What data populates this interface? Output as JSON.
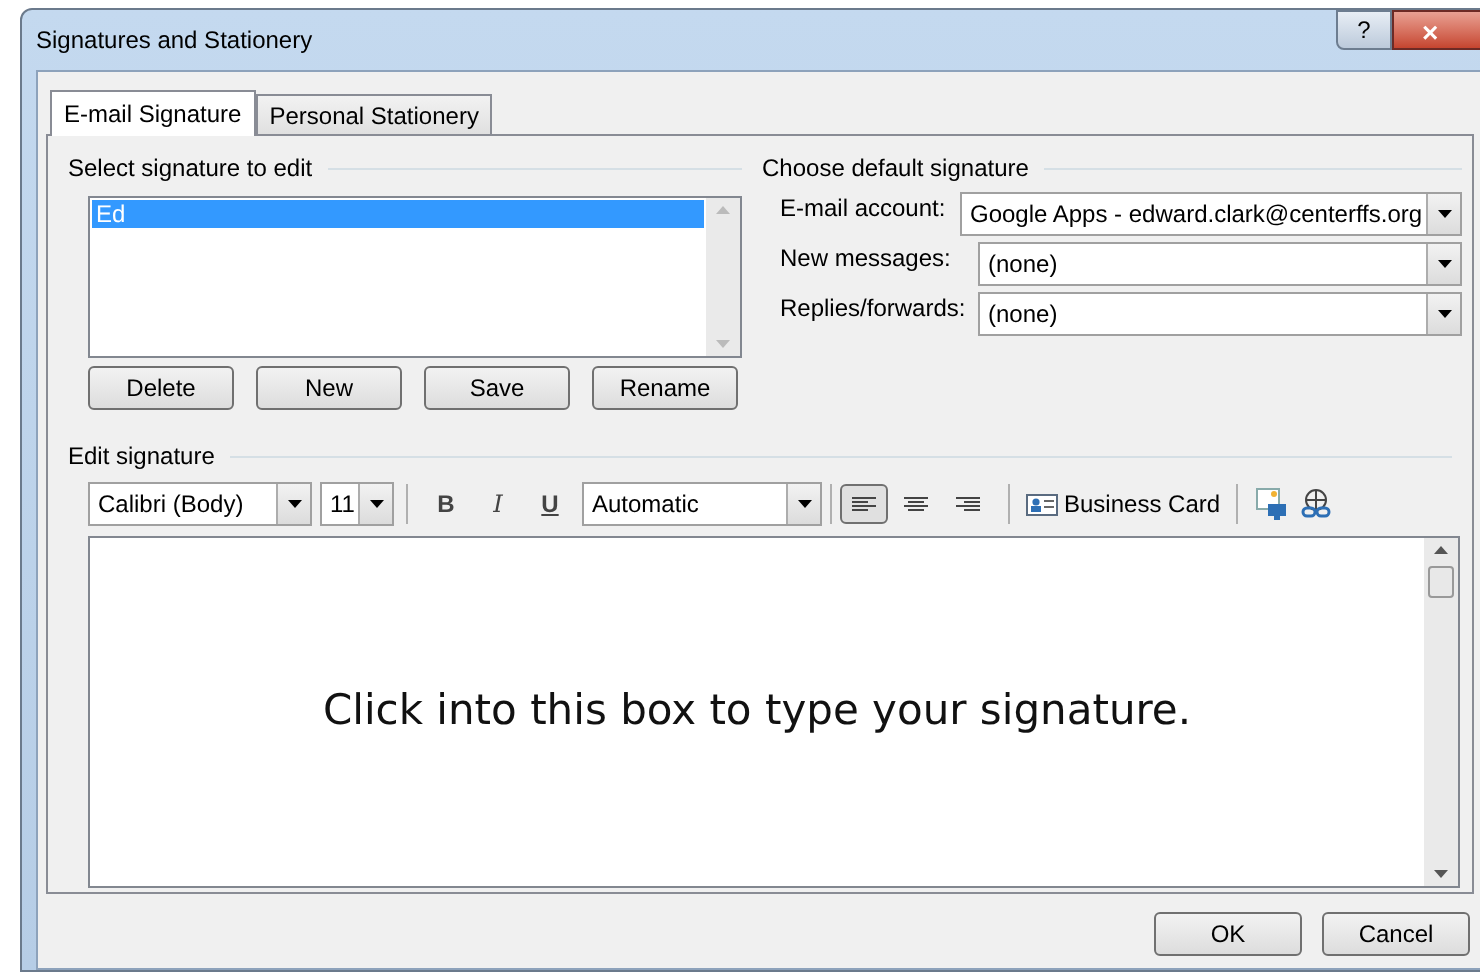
{
  "window": {
    "title": "Signatures and Stationery",
    "help_button": "?",
    "close_button": "×"
  },
  "tabs": [
    {
      "label": "E-mail Signature",
      "selected": true
    },
    {
      "label": "Personal Stationery",
      "selected": false
    }
  ],
  "select_signature": {
    "heading": "Select signature to edit",
    "items": [
      {
        "label": "Ed",
        "selected": true
      }
    ],
    "buttons": [
      "Delete",
      "New",
      "Save",
      "Rename"
    ]
  },
  "default_signature": {
    "heading": "Choose default signature",
    "fields": [
      {
        "label": "E-mail account:",
        "value": "Google Apps - edward.clark@centerffs.org"
      },
      {
        "label": "New messages:",
        "value": "(none)"
      },
      {
        "label": "Replies/forwards:",
        "value": "(none)"
      }
    ]
  },
  "edit_signature": {
    "heading": "Edit signature",
    "font": "Calibri (Body)",
    "size": "11",
    "format_buttons": [
      {
        "label": "B",
        "kind": "bold"
      },
      {
        "label": "I",
        "kind": "italic"
      },
      {
        "label": "U",
        "kind": "underline"
      }
    ],
    "font_color": "Automatic",
    "alignment": [
      {
        "kind": "left",
        "selected": true
      },
      {
        "kind": "center",
        "selected": false
      },
      {
        "kind": "right",
        "selected": false
      }
    ],
    "business_card": "Business Card",
    "placeholder": "Click into this box to type your signature."
  },
  "buttons": [
    "OK",
    "Cancel"
  ]
}
